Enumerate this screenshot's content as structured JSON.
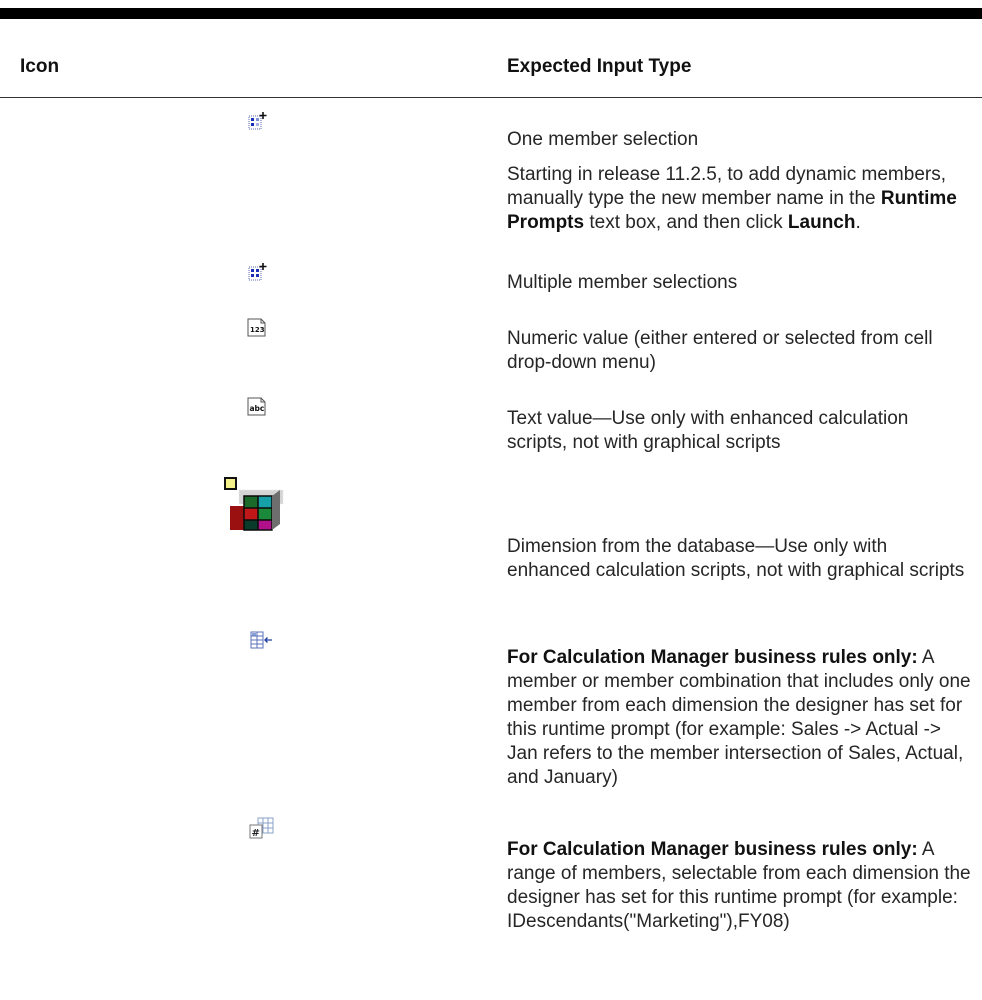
{
  "table": {
    "headers": {
      "icon": "Icon",
      "expected_input_type": "Expected Input Type"
    },
    "rows": [
      {
        "icon": "one-member-selection-icon",
        "line1": "One member selection",
        "p2_a": "Starting in release 11.2.5, to add dynamic members, manually type the new member name in the ",
        "p2_b": "Runtime Prompts",
        "p2_c": " text box, and then click ",
        "p2_d": "Launch",
        "p2_e": "."
      },
      {
        "icon": "multiple-member-selection-icon",
        "line1": "Multiple member selections"
      },
      {
        "icon": "numeric-value-icon",
        "line1": "Numeric value (either entered or selected from cell drop-down menu)"
      },
      {
        "icon": "text-value-icon",
        "line1": "Text value—Use only with enhanced calculation scripts, not with graphical scripts"
      },
      {
        "icon": "dimension-icon",
        "line1": "Dimension from the database—Use only with enhanced calculation scripts, not with graphical scripts"
      },
      {
        "icon": "cross-dimension-icon",
        "bold": "For Calculation Manager business rules only:",
        "rest": " A member or member combination that includes only one member from each dimension the designer has set for this runtime prompt (for example: Sales -> Actual -> Jan refers to the member intersection of Sales, Actual, and January)"
      },
      {
        "icon": "member-range-icon",
        "bold": "For Calculation Manager business rules only:",
        "rest": " A range of members, selectable from each dimension the designer has set for this runtime prompt (for example: IDescendants(\"Marketing\"),FY08)"
      }
    ]
  }
}
